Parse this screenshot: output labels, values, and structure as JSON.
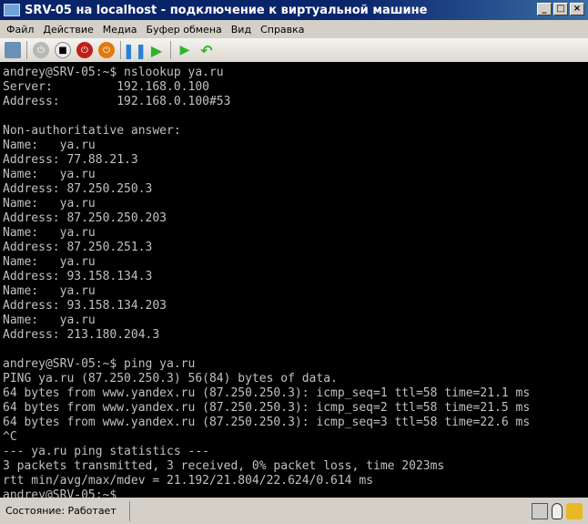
{
  "window": {
    "title": "SRV-05 на localhost - подключение к виртуальной машине"
  },
  "menu": [
    "Файл",
    "Действие",
    "Медиа",
    "Буфер обмена",
    "Вид",
    "Справка"
  ],
  "toolbar": [
    "ctrl-alt-del",
    "start",
    "turn-off",
    "shut-down",
    "save",
    "pause",
    "reset",
    "snapshot",
    "revert"
  ],
  "terminal": {
    "lines": [
      "andrey@SRV-05:~$ nslookup ya.ru",
      "Server:         192.168.0.100",
      "Address:        192.168.0.100#53",
      "",
      "Non-authoritative answer:",
      "Name:   ya.ru",
      "Address: 77.88.21.3",
      "Name:   ya.ru",
      "Address: 87.250.250.3",
      "Name:   ya.ru",
      "Address: 87.250.250.203",
      "Name:   ya.ru",
      "Address: 87.250.251.3",
      "Name:   ya.ru",
      "Address: 93.158.134.3",
      "Name:   ya.ru",
      "Address: 93.158.134.203",
      "Name:   ya.ru",
      "Address: 213.180.204.3",
      "",
      "andrey@SRV-05:~$ ping ya.ru",
      "PING ya.ru (87.250.250.3) 56(84) bytes of data.",
      "64 bytes from www.yandex.ru (87.250.250.3): icmp_seq=1 ttl=58 time=21.1 ms",
      "64 bytes from www.yandex.ru (87.250.250.3): icmp_seq=2 ttl=58 time=21.5 ms",
      "64 bytes from www.yandex.ru (87.250.250.3): icmp_seq=3 ttl=58 time=22.6 ms",
      "^C",
      "--- ya.ru ping statistics ---",
      "3 packets transmitted, 3 received, 0% packet loss, time 2023ms",
      "rtt min/avg/max/mdev = 21.192/21.804/22.624/0.614 ms",
      "andrey@SRV-05:~$ _"
    ]
  },
  "status": {
    "text": "Состояние: Работает"
  }
}
